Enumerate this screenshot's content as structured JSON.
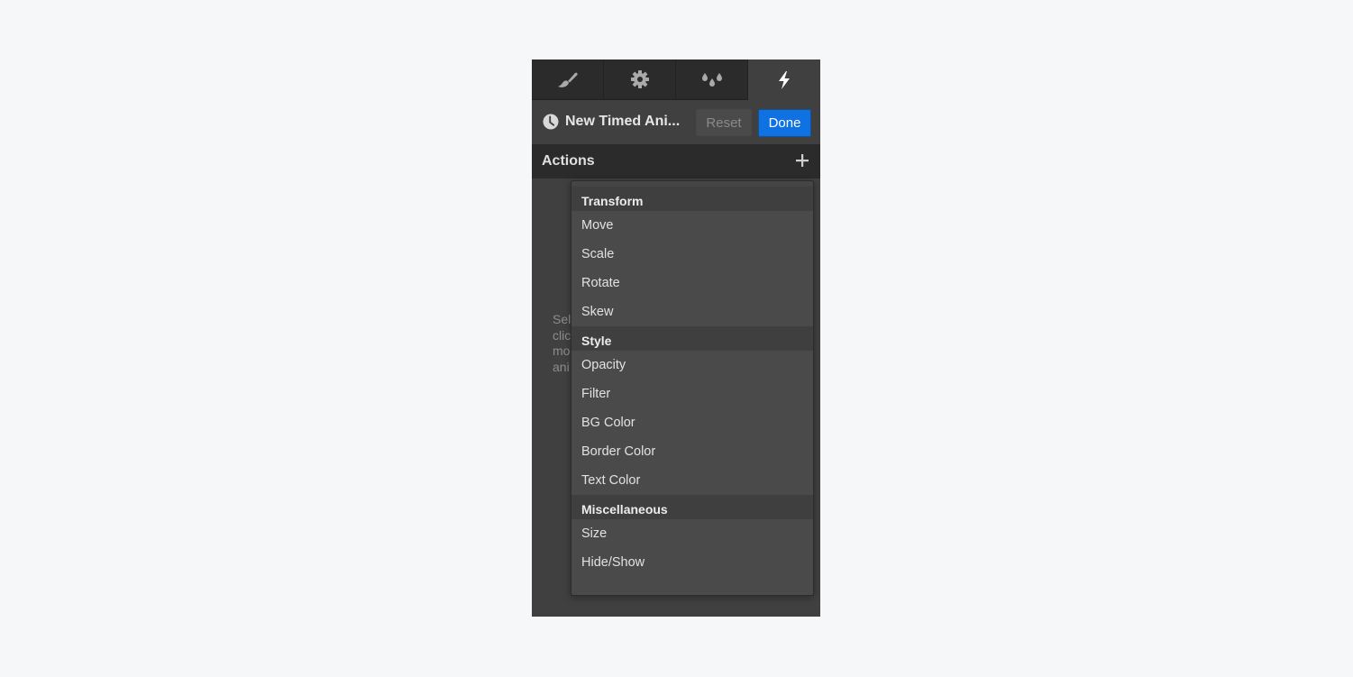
{
  "tabs": [
    {
      "icon": "paintbrush-icon",
      "label": "Style",
      "active": false
    },
    {
      "icon": "gear-icon",
      "label": "Settings",
      "active": false
    },
    {
      "icon": "droplets-icon",
      "label": "Style manager",
      "active": false
    },
    {
      "icon": "lightning-icon",
      "label": "Interactions",
      "active": true
    }
  ],
  "header": {
    "icon": "clock-icon",
    "title": "New Timed Ani...",
    "reset_label": "Reset",
    "done_label": "Done"
  },
  "actions_section": {
    "title": "Actions",
    "add_icon": "plus-icon"
  },
  "hint_fragments": [
    "Sel",
    "clic",
    "mo",
    "ani"
  ],
  "dropdown": {
    "groups": [
      {
        "title": "Transform",
        "items": [
          "Move",
          "Scale",
          "Rotate",
          "Skew"
        ]
      },
      {
        "title": "Style",
        "items": [
          "Opacity",
          "Filter",
          "BG Color",
          "Border Color",
          "Text Color"
        ]
      },
      {
        "title": "Miscellaneous",
        "items": [
          "Size",
          "Hide/Show"
        ]
      }
    ]
  },
  "colors": {
    "accent": "#0e72e2",
    "panel_bg": "#404040",
    "dark_bar": "#2b2b2b",
    "page_bg": "#f6f7f9"
  }
}
